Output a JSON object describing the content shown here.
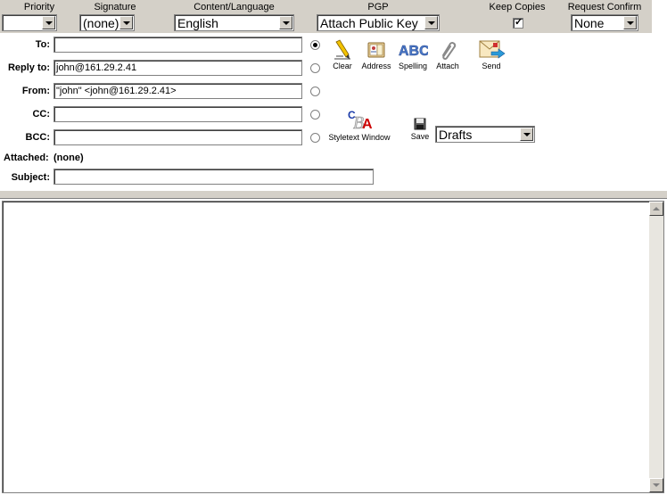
{
  "options_bar": {
    "priority": {
      "label": "Priority",
      "value": ""
    },
    "signature": {
      "label": "Signature",
      "value": "(none)"
    },
    "content_language": {
      "label": "Content/Language",
      "value": "English"
    },
    "pgp": {
      "label": "PGP",
      "value": "Attach Public Key"
    },
    "keep_copies": {
      "label": "Keep Copies",
      "checked": true,
      "mark": "✓"
    },
    "request_confirm": {
      "label": "Request Confirm",
      "value": "None"
    }
  },
  "form": {
    "to": {
      "label": "To:",
      "value": "",
      "selected": true
    },
    "reply_to": {
      "label": "Reply to:",
      "value": "john@161.29.2.41",
      "selected": false
    },
    "from": {
      "label": "From:",
      "value": "\"john\" <john@161.29.2.41>",
      "selected": false
    },
    "cc": {
      "label": "CC:",
      "value": "",
      "selected": false
    },
    "bcc": {
      "label": "BCC:",
      "value": "",
      "selected": false
    },
    "attached": {
      "label": "Attached:",
      "value": "(none)"
    },
    "subject": {
      "label": "Subject:",
      "value": ""
    }
  },
  "toolbar": {
    "clear": "Clear",
    "address": "Address",
    "spelling": "Spelling",
    "spelling_icon_text": "ABC",
    "attach": "Attach",
    "send": "Send",
    "styletext": "Styletext Window",
    "save": "Save",
    "save_folder": "Drafts"
  },
  "icons": {
    "clear": "pencil-icon",
    "address": "address-book-icon",
    "spelling": "spelling-icon",
    "attach": "paperclip-icon",
    "send": "send-envelope-icon",
    "styletext": "styletext-icon",
    "save": "floppy-disk-icon"
  },
  "colors": {
    "chrome": "#d4d0c8",
    "spelling_blue": "#4a78c8",
    "style_red": "#cc0000",
    "style_blue": "#1a3aa8"
  }
}
